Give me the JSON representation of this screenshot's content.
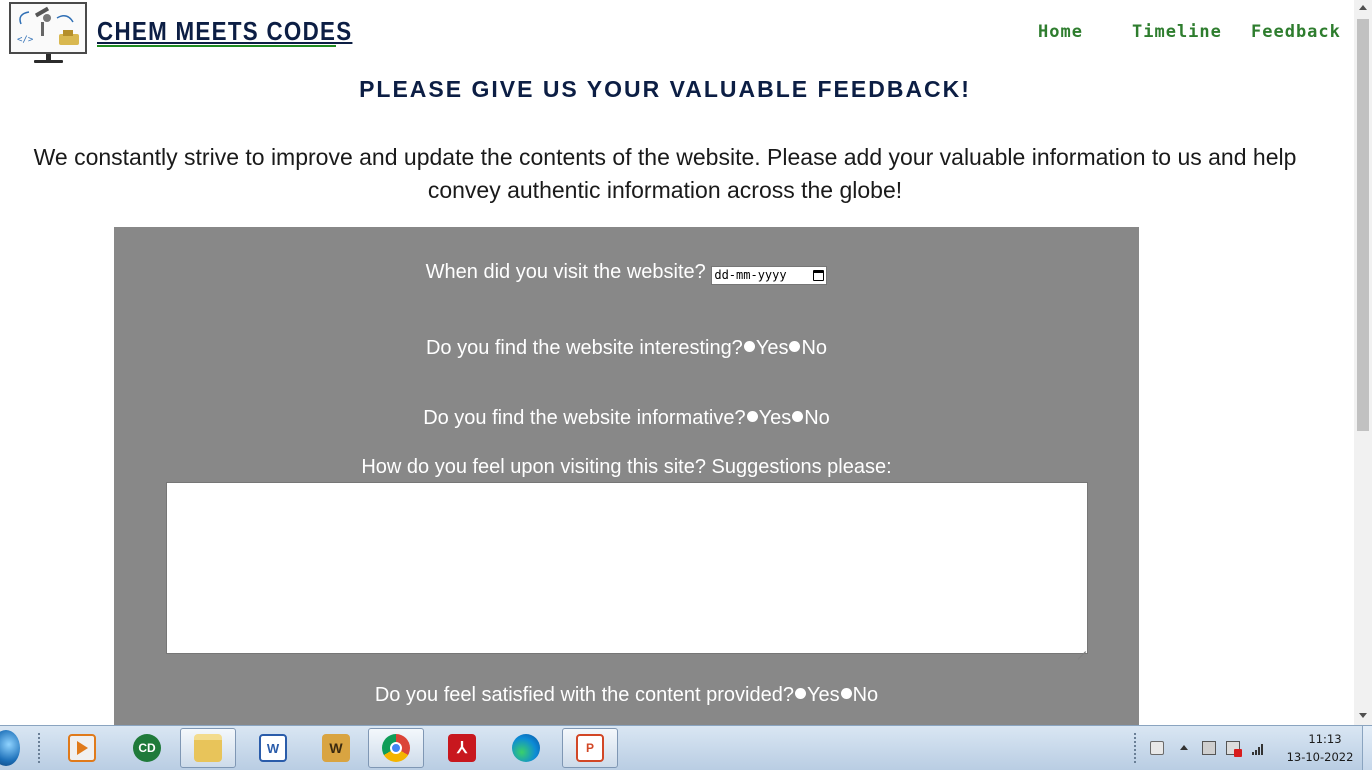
{
  "site": {
    "title": "CHEM MEETS CODES",
    "nav": [
      "Home",
      "Timeline",
      "Feedback"
    ]
  },
  "heading": "PLEASE GIVE US YOUR VALUABLE FEEDBACK!",
  "intro": "We constantly strive to improve and update the contents of the website. Please add your valuable information to us and help convey authentic information across the globe!",
  "form": {
    "visit_question": "When did you visit the website?",
    "date_placeholder": "dd-mm-yyyy",
    "interesting_question": "Do you find the website interesting?",
    "informative_question": "Do you find the website informative?",
    "suggestions_label": "How do you feel upon visiting this site? Suggestions please:",
    "satisfied_question": "Do you feel satisfied with the content provided?",
    "yes_label": "Yes",
    "no_label": "No"
  },
  "taskbar": {
    "apps": [
      "media-player",
      "chemdraw",
      "file-explorer",
      "word-2007",
      "word",
      "chrome",
      "acrobat-reader",
      "edge",
      "powerpoint"
    ],
    "active_apps": [
      "file-explorer",
      "chrome",
      "powerpoint"
    ],
    "time": "11:13",
    "date": "13-10-2022"
  },
  "colors": {
    "title": "#0c1e44",
    "nav": "#2e7d2e",
    "panel": "#888888"
  }
}
